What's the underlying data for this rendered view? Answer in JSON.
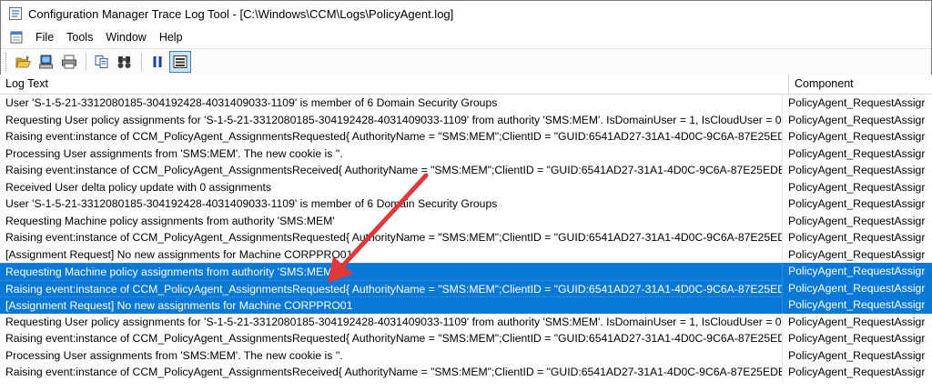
{
  "window": {
    "title": "Configuration Manager Trace Log Tool - [C:\\Windows\\CCM\\Logs\\PolicyAgent.log]"
  },
  "menu": [
    "File",
    "Tools",
    "Window",
    "Help"
  ],
  "toolbar": {
    "buttons": [
      "open-icon",
      "print-preview-icon",
      "print-icon",
      "copy-icon",
      "find-icon",
      "pause-icon",
      "filter-icon"
    ]
  },
  "columns": {
    "log_text": "Log Text",
    "component": "Component"
  },
  "rows": [
    {
      "log": "User 'S-1-5-21-3312080185-304192428-4031409033-1109' is member of 6 Domain Security Groups",
      "component": "PolicyAgent_RequestAssigr",
      "selected": false
    },
    {
      "log": "Requesting User policy assignments for 'S-1-5-21-3312080185-304192428-4031409033-1109' from authority 'SMS:MEM'. IsDomainUser = 1, IsCloudUser = 0",
      "component": "PolicyAgent_RequestAssigr",
      "selected": false
    },
    {
      "log": "Raising event:instance of CCM_PolicyAgent_AssignmentsRequested{ AuthorityName = \"SMS:MEM\";ClientID = \"GUID:6541AD27-31A1-4D0C-9C6A-87E25EDE13A0\";...",
      "component": "PolicyAgent_RequestAssigr",
      "selected": false
    },
    {
      "log": "Processing User assignments from 'SMS:MEM'. The new cookie is ''.",
      "component": "PolicyAgent_RequestAssigr",
      "selected": false
    },
    {
      "log": "Raising event:instance of CCM_PolicyAgent_AssignmentsReceived{ AuthorityName = \"SMS:MEM\";ClientID = \"GUID:6541AD27-31A1-4D0C-9C6A-87E25EDE13A0\";D...",
      "component": "PolicyAgent_RequestAssigr",
      "selected": false
    },
    {
      "log": "Received User delta policy update with 0 assignments",
      "component": "PolicyAgent_RequestAssigr",
      "selected": false
    },
    {
      "log": "User 'S-1-5-21-3312080185-304192428-4031409033-1109' is member of 6 Domain Security Groups",
      "component": "PolicyAgent_RequestAssigr",
      "selected": false
    },
    {
      "log": "Requesting Machine policy assignments from authority 'SMS:MEM'",
      "component": "PolicyAgent_RequestAssigr",
      "selected": false
    },
    {
      "log": "Raising event:instance of CCM_PolicyAgent_AssignmentsRequested{ AuthorityName = \"SMS:MEM\";ClientID = \"GUID:6541AD27-31A1-4D0C-9C6A-87E25EDE13A0\";...",
      "component": "PolicyAgent_RequestAssigr",
      "selected": false
    },
    {
      "log": "[Assignment Request] No new assignments for Machine CORPPRO01",
      "component": "PolicyAgent_RequestAssigr",
      "selected": false
    },
    {
      "log": "Requesting Machine policy assignments from authority 'SMS:MEM'",
      "component": "PolicyAgent_RequestAssigr",
      "selected": true
    },
    {
      "log": "Raising event:instance of CCM_PolicyAgent_AssignmentsRequested{ AuthorityName = \"SMS:MEM\";ClientID = \"GUID:6541AD27-31A1-4D0C-9C6A-87E25EDE13A0\";...",
      "component": "PolicyAgent_RequestAssigr",
      "selected": true
    },
    {
      "log": "[Assignment Request] No new assignments for Machine CORPPRO01",
      "component": "PolicyAgent_RequestAssigr",
      "selected": true
    },
    {
      "log": "Requesting User policy assignments for 'S-1-5-21-3312080185-304192428-4031409033-1109' from authority 'SMS:MEM'. IsDomainUser = 1, IsCloudUser = 0",
      "component": "PolicyAgent_RequestAssigr",
      "selected": false
    },
    {
      "log": "Raising event:instance of CCM_PolicyAgent_AssignmentsRequested{ AuthorityName = \"SMS:MEM\";ClientID = \"GUID:6541AD27-31A1-4D0C-9C6A-87E25EDE13A0\";...",
      "component": "PolicyAgent_RequestAssigr",
      "selected": false
    },
    {
      "log": "Processing User assignments from 'SMS:MEM'. The new cookie is ''.",
      "component": "PolicyAgent_RequestAssigr",
      "selected": false
    },
    {
      "log": "Raising event:instance of CCM_PolicyAgent_AssignmentsReceived{ AuthorityName = \"SMS:MEM\";ClientID = \"GUID:6541AD27-31A1-4D0C-9C6A-87E25EDE13A0\";D...",
      "component": "PolicyAgent_RequestAssigr",
      "selected": false
    }
  ],
  "colors": {
    "selection": "#0a78d7",
    "annotation_arrow": "#e0393b"
  }
}
